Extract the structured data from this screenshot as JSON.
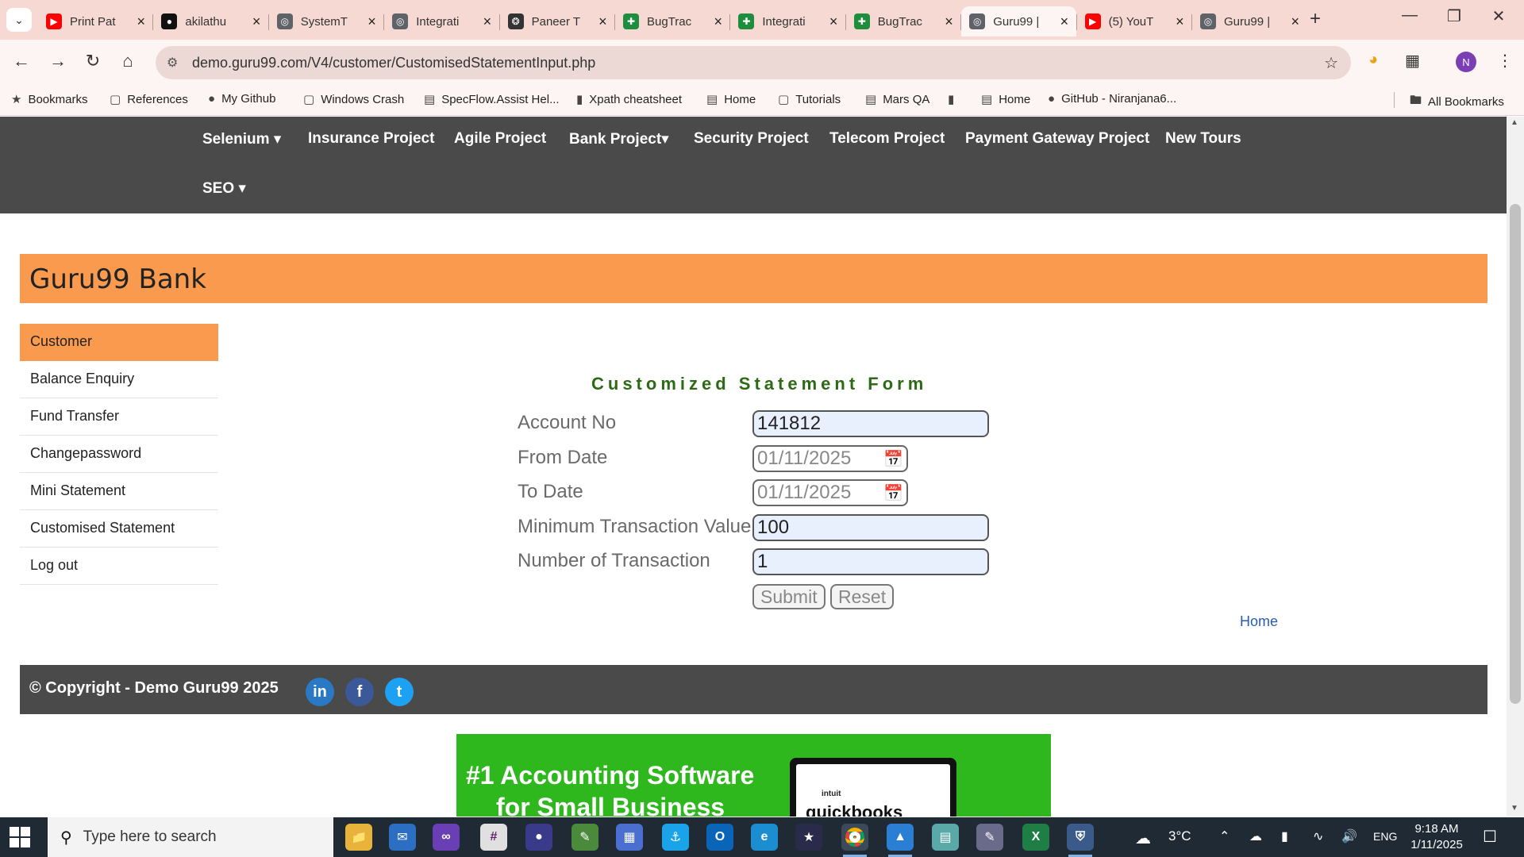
{
  "browser": {
    "tabs": [
      {
        "title": "Print Pat",
        "icon": "youtube-icon",
        "color": "#ff0000",
        "active": false
      },
      {
        "title": "akilathu",
        "icon": "github-icon",
        "color": "#111111",
        "active": false
      },
      {
        "title": "SystemT",
        "icon": "globe-icon",
        "color": "#5f6368",
        "active": false
      },
      {
        "title": "Integrati",
        "icon": "globe-icon",
        "color": "#5f6368",
        "active": false
      },
      {
        "title": "Paneer T",
        "icon": "chatgpt-icon",
        "color": "#333333",
        "active": false
      },
      {
        "title": "BugTrac",
        "icon": "sheets-icon",
        "color": "#1e8e3e",
        "active": false
      },
      {
        "title": "Integrati",
        "icon": "sheets-icon",
        "color": "#1e8e3e",
        "active": false
      },
      {
        "title": "BugTrac",
        "icon": "sheets-icon",
        "color": "#1e8e3e",
        "active": false
      },
      {
        "title": "Guru99 |",
        "icon": "globe-icon",
        "color": "#5f6368",
        "active": true
      },
      {
        "title": "(5) YouT",
        "icon": "youtube-icon",
        "color": "#ff0000",
        "active": false
      },
      {
        "title": "Guru99 |",
        "icon": "globe-icon",
        "color": "#5f6368",
        "active": false
      }
    ],
    "url": "demo.guru99.com/V4/customer/CustomisedStatementInput.php",
    "profile_initial": "N",
    "bookmarks": [
      {
        "label": "Bookmarks",
        "icon": "star-icon"
      },
      {
        "label": "References",
        "icon": "folder-icon"
      },
      {
        "label": "My Github",
        "icon": "github-icon"
      },
      {
        "label": "Windows Crash",
        "icon": "folder-icon"
      },
      {
        "label": "SpecFlow.Assist Hel...",
        "icon": "page-icon"
      },
      {
        "label": "Xpath cheatsheet",
        "icon": "bookmark-icon"
      },
      {
        "label": "Home",
        "icon": "page-icon"
      },
      {
        "label": "Tutorials",
        "icon": "folder-icon"
      },
      {
        "label": "Mars QA",
        "icon": "page-icon"
      },
      {
        "label": "",
        "icon": "bookmark-icon"
      },
      {
        "label": "Home",
        "icon": "page-icon"
      },
      {
        "label": "GitHub - Niranjana6...",
        "icon": "github-icon"
      }
    ],
    "all_bookmarks": "All Bookmarks"
  },
  "nav": {
    "items": [
      {
        "label": "Selenium ▾"
      },
      {
        "label": "Insurance Project"
      },
      {
        "label": "Agile Project"
      },
      {
        "label": "Bank Project▾"
      },
      {
        "label": "Security Project"
      },
      {
        "label": "Telecom Project"
      },
      {
        "label": "Payment Gateway Project"
      },
      {
        "label": "New Tours"
      },
      {
        "label": "SEO ▾"
      }
    ]
  },
  "banner": {
    "title": "Guru99 Bank",
    "color": "#f99a4e"
  },
  "sidebar": {
    "items": [
      {
        "label": "Customer",
        "active": true
      },
      {
        "label": "Balance Enquiry",
        "active": false
      },
      {
        "label": "Fund Transfer",
        "active": false
      },
      {
        "label": "Changepassword",
        "active": false
      },
      {
        "label": "Mini Statement",
        "active": false
      },
      {
        "label": "Customised Statement",
        "active": false
      },
      {
        "label": "Log out",
        "active": false
      }
    ]
  },
  "form": {
    "title": "Customized Statement Form",
    "fields": [
      {
        "label": "Account No",
        "value": "141812",
        "type": "text"
      },
      {
        "label": "From Date",
        "value": "01/11/2025",
        "type": "date"
      },
      {
        "label": "To Date",
        "value": "01/11/2025",
        "type": "date"
      },
      {
        "label": "Minimum Transaction Value",
        "value": "100",
        "type": "text"
      },
      {
        "label": "Number of Transaction",
        "value": "1",
        "type": "text"
      }
    ],
    "submit_label": "Submit",
    "reset_label": "Reset",
    "title_color": "#2d6a15"
  },
  "home_link": "Home",
  "footer": {
    "copyright": "© Copyright - Demo Guru99 2025",
    "social": [
      {
        "name": "linkedin",
        "glyph": "in"
      },
      {
        "name": "facebook",
        "glyph": "f"
      },
      {
        "name": "twitter",
        "glyph": "t"
      }
    ]
  },
  "ad": {
    "headline": "#1 Accounting Software",
    "subline": "for Small Business",
    "brand_top": "intuit",
    "brand": "quickbooks"
  },
  "taskbar": {
    "search_placeholder": "Type here to search",
    "temperature": "3°C",
    "language": "ENG",
    "time": "9:18 AM",
    "date": "1/11/2025"
  }
}
